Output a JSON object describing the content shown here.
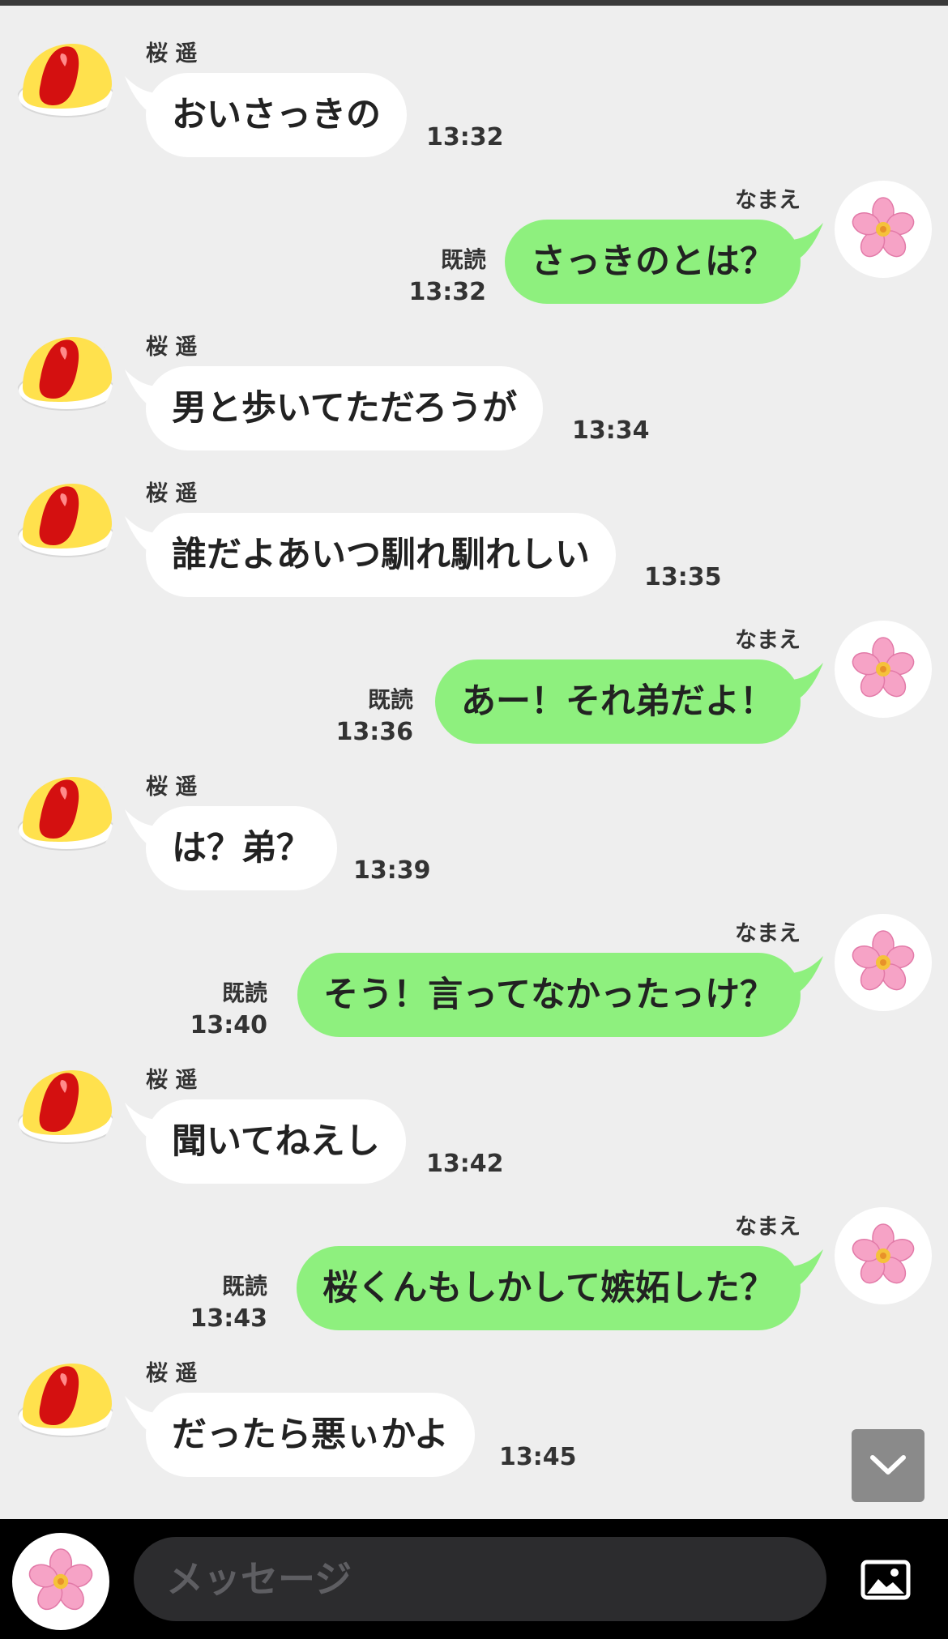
{
  "partner": {
    "name": "桜 遥",
    "avatar_icon": "omurice-icon"
  },
  "me": {
    "name": "なまえ",
    "avatar_icon": "cherry-blossom-icon"
  },
  "read_label": "既読",
  "messages": [
    {
      "side": "left",
      "text": "おいさっきの",
      "time": "13:32"
    },
    {
      "side": "right",
      "text": "さっきのとは？",
      "time": "13:32",
      "read": true
    },
    {
      "side": "left",
      "text": "男と歩いてただろうが",
      "time": "13:34"
    },
    {
      "side": "left",
      "text": "誰だよあいつ馴れ馴れしい",
      "time": "13:35"
    },
    {
      "side": "right",
      "text": "あー！それ弟だよ！",
      "time": "13:36",
      "read": true
    },
    {
      "side": "left",
      "text": "は？弟？",
      "time": "13:39"
    },
    {
      "side": "right",
      "text": "そう！言ってなかったっけ？",
      "time": "13:40",
      "read": true
    },
    {
      "side": "left",
      "text": "聞いてねえし",
      "time": "13:42"
    },
    {
      "side": "right",
      "text": "桜くんもしかして嫉妬した？",
      "time": "13:43",
      "read": true
    },
    {
      "side": "left",
      "text": "だったら悪ぃかよ",
      "time": "13:45"
    }
  ],
  "composer": {
    "placeholder": "メッセージ",
    "image_icon": "image-icon"
  },
  "scroll_button_icon": "chevron-down-icon",
  "colors": {
    "background": "#eeeeee",
    "my_bubble": "#8ef07e",
    "their_bubble": "#ffffff",
    "bottom_bar": "#000000"
  }
}
